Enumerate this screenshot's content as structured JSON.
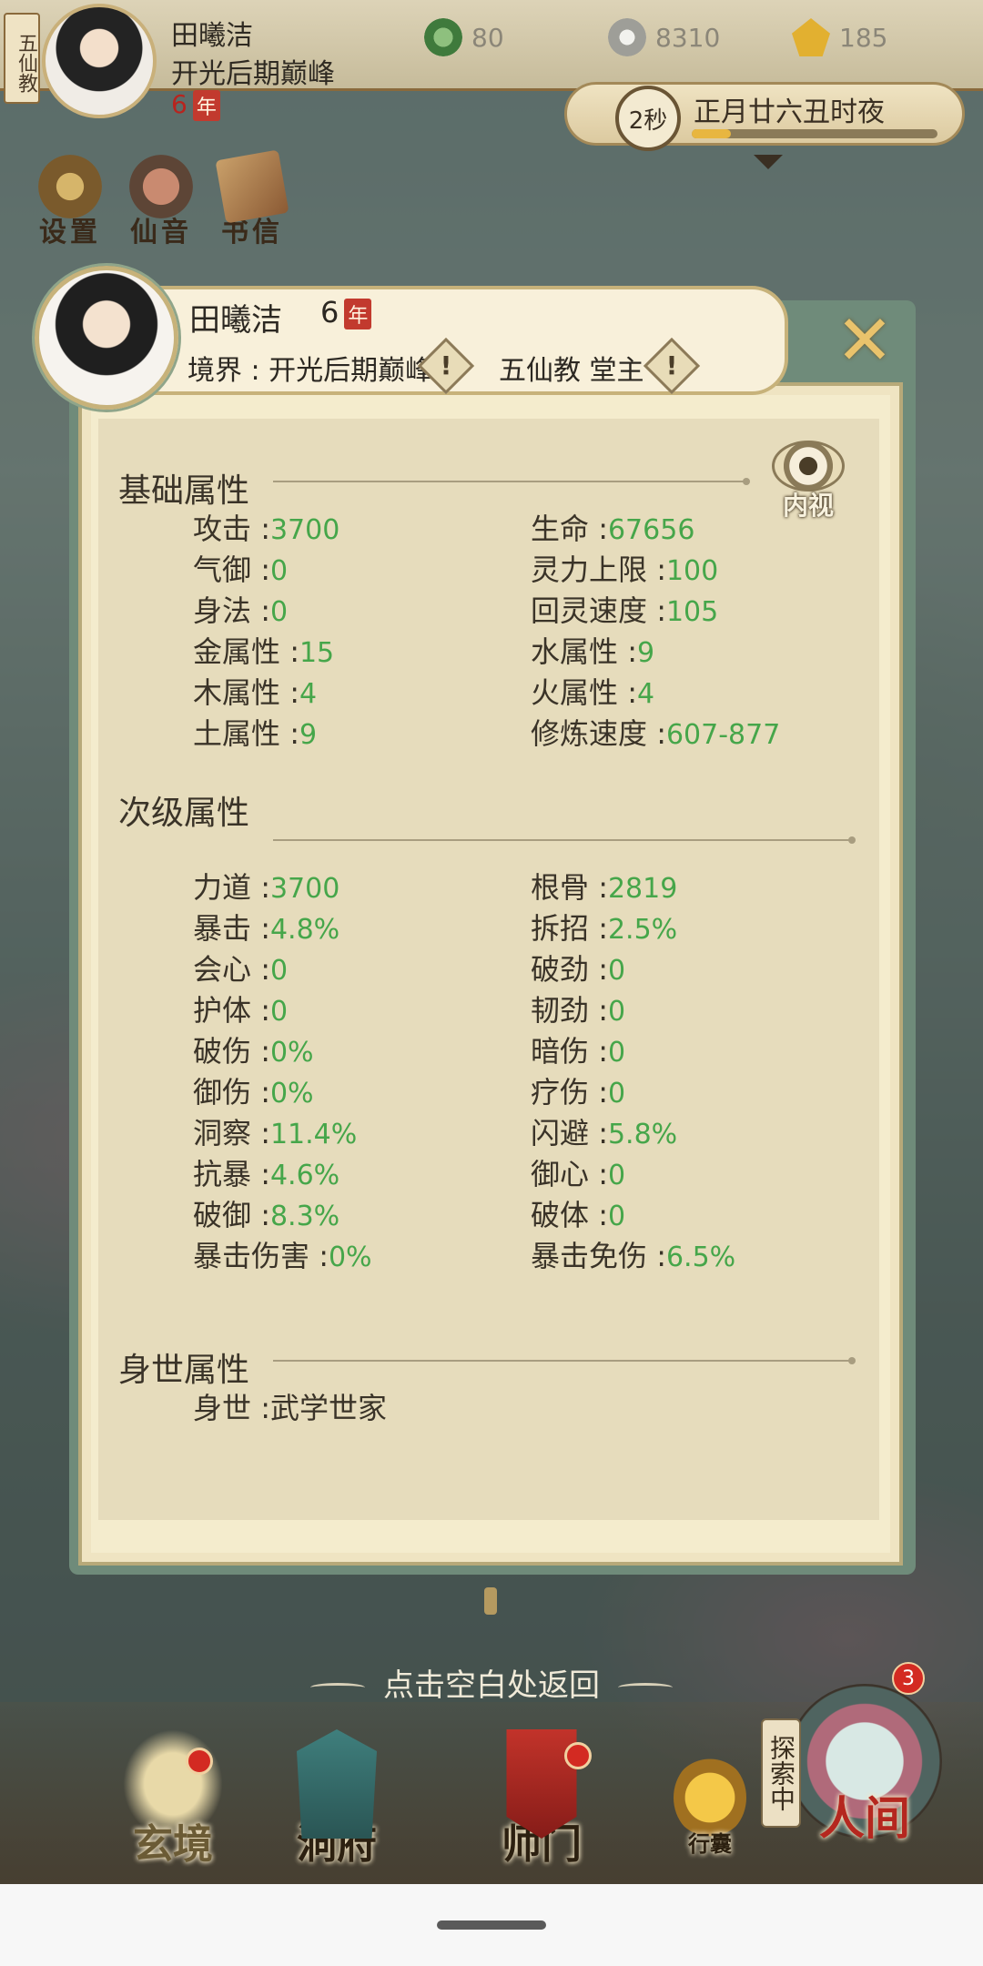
{
  "hud": {
    "sect_tab": "五仙教",
    "name": "田曦洁",
    "realm": "开光后期巅峰",
    "age": "6",
    "year_badge": "年",
    "resources": [
      {
        "icon": "jade-coin-icon",
        "value": "80"
      },
      {
        "icon": "copper-coin-icon",
        "value": "8310"
      },
      {
        "icon": "gold-ingot-icon",
        "value": "185"
      }
    ],
    "timer": "2秒",
    "calendar": "正月廿六丑时夜",
    "timer_progress": 0.16,
    "quick_buttons": [
      "设置",
      "仙音",
      "书信"
    ]
  },
  "panel": {
    "name": "田曦洁",
    "age": "6",
    "year_badge": "年",
    "realm_label": "境界 : 开光后期巅峰",
    "sect_label": "五仙教 堂主",
    "warn_glyph": "!",
    "close_glyph": "✕",
    "inner_view_label": "内视",
    "sections": {
      "basic": {
        "title": "基础属性",
        "rows": [
          [
            {
              "label": "攻击",
              "value": "3700"
            },
            {
              "label": "生命",
              "value": "67656"
            }
          ],
          [
            {
              "label": "气御",
              "value": "0"
            },
            {
              "label": "灵力上限",
              "value": "100"
            }
          ],
          [
            {
              "label": "身法",
              "value": "0"
            },
            {
              "label": "回灵速度",
              "value": "105"
            }
          ],
          [
            {
              "label": "金属性",
              "value": "15"
            },
            {
              "label": "水属性",
              "value": "9"
            }
          ],
          [
            {
              "label": "木属性",
              "value": "4"
            },
            {
              "label": "火属性",
              "value": "4"
            }
          ],
          [
            {
              "label": "土属性",
              "value": "9"
            },
            {
              "label": "修炼速度",
              "value": "607-877"
            }
          ]
        ]
      },
      "secondary": {
        "title": "次级属性",
        "rows": [
          [
            {
              "label": "力道",
              "value": "3700"
            },
            {
              "label": "根骨",
              "value": "2819"
            }
          ],
          [
            {
              "label": "暴击",
              "value": "4.8%"
            },
            {
              "label": "拆招",
              "value": "2.5%"
            }
          ],
          [
            {
              "label": "会心",
              "value": "0"
            },
            {
              "label": "破劲",
              "value": "0"
            }
          ],
          [
            {
              "label": "护体",
              "value": "0"
            },
            {
              "label": "韧劲",
              "value": "0"
            }
          ],
          [
            {
              "label": "破伤",
              "value": "0%"
            },
            {
              "label": "暗伤",
              "value": "0"
            }
          ],
          [
            {
              "label": "御伤",
              "value": "0%"
            },
            {
              "label": "疗伤",
              "value": "0"
            }
          ],
          [
            {
              "label": "洞察",
              "value": "11.4%"
            },
            {
              "label": "闪避",
              "value": "5.8%"
            }
          ],
          [
            {
              "label": "抗暴",
              "value": "4.6%"
            },
            {
              "label": "御心",
              "value": "0"
            }
          ],
          [
            {
              "label": "破御",
              "value": "8.3%"
            },
            {
              "label": "破体",
              "value": "0"
            }
          ],
          [
            {
              "label": "暴击伤害",
              "value": "0%"
            },
            {
              "label": "暴击免伤",
              "value": "6.5%"
            }
          ]
        ]
      },
      "background": {
        "title": "身世属性",
        "rows": [
          [
            {
              "label": "身世",
              "value": "武学世家"
            }
          ]
        ]
      }
    }
  },
  "back_hint": "点击空白处返回",
  "bottom_nav": {
    "items": [
      {
        "label": "玄境",
        "icon": "scroll-icon"
      },
      {
        "label": "洞府",
        "icon": "pavilion-icon"
      },
      {
        "label": "师门",
        "icon": "banner-icon"
      },
      {
        "label": "行囊",
        "icon": "bag-icon"
      },
      {
        "label": "人间",
        "icon": "world-orb-icon"
      }
    ],
    "explore_tag": "探索中",
    "world_badge": "3"
  },
  "colors": {
    "attr_value": "#46a64a",
    "panel_bg": "#f4eccd",
    "accent_red": "#c23a2e"
  }
}
